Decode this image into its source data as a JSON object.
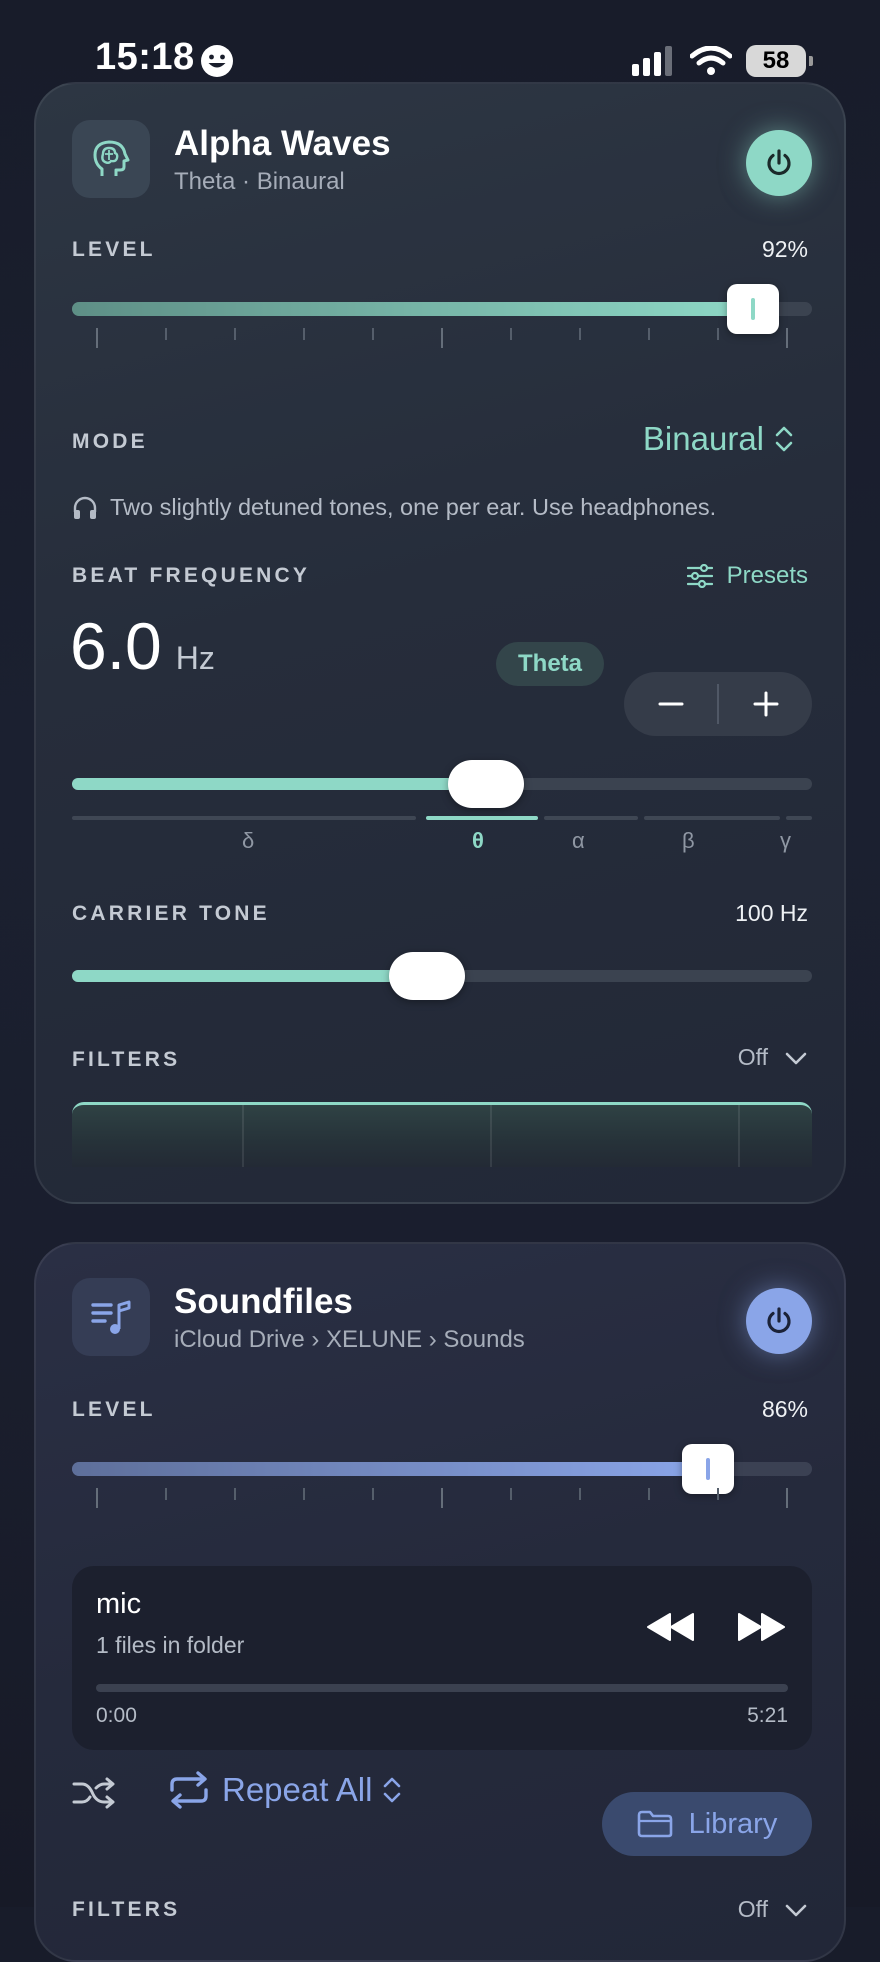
{
  "status": {
    "time": "15:18",
    "battery": "58"
  },
  "colors": {
    "teal": "#8ed8c6",
    "blue": "#8aa5e8"
  },
  "alpha": {
    "title": "Alpha Waves",
    "subtitle": "Theta · Binaural",
    "icon": "head-brain-icon",
    "level_label": "LEVEL",
    "level_value": "92%",
    "level_fraction": 0.92,
    "mode_label": "MODE",
    "mode_value": "Binaural",
    "description": "Two slightly detuned tones, one per ear. Use headphones.",
    "beat_label": "BEAT FREQUENCY",
    "presets_label": "Presets",
    "beat_value": "6.0",
    "beat_unit": "Hz",
    "band_badge": "Theta",
    "minus": "−",
    "plus": "+",
    "beat_fraction": 0.56,
    "bands": [
      {
        "symbol": "δ",
        "active": false
      },
      {
        "symbol": "θ",
        "active": true
      },
      {
        "symbol": "α",
        "active": false
      },
      {
        "symbol": "β",
        "active": false
      },
      {
        "symbol": "γ",
        "active": false
      }
    ],
    "carrier_label": "CARRIER TONE",
    "carrier_value": "100 Hz",
    "carrier_fraction": 0.48,
    "filters_label": "FILTERS",
    "filters_value": "Off"
  },
  "soundfiles": {
    "title": "Soundfiles",
    "subtitle": "iCloud Drive › XELUNE › Sounds",
    "icon": "music-list-icon",
    "level_label": "LEVEL",
    "level_value": "86%",
    "level_fraction": 0.86,
    "file_name": "mic",
    "file_count": "1 files in folder",
    "time_current": "0:00",
    "time_total": "5:21",
    "playback_fraction": 0.0,
    "repeat_label": "Repeat All",
    "library_label": "Library",
    "filters_label": "FILTERS",
    "filters_value": "Off"
  }
}
